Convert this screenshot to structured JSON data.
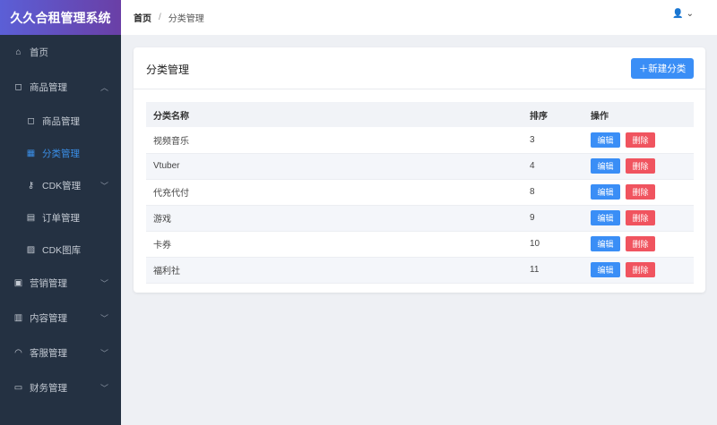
{
  "app_title": "久久合租管理系统",
  "sidebar": [
    {
      "label": "首页",
      "icon": "home-icon"
    },
    {
      "label": "商品管理",
      "icon": "bag-icon",
      "chevron": "up"
    },
    {
      "label": "商品管理",
      "icon": "bag-icon",
      "sub": true
    },
    {
      "label": "分类管理",
      "icon": "grid-icon",
      "sub": true,
      "active": true
    },
    {
      "label": "CDK管理",
      "icon": "key-icon",
      "sub": true,
      "chevron": "down"
    },
    {
      "label": "订单管理",
      "icon": "clipboard-icon",
      "sub": true
    },
    {
      "label": "CDK图库",
      "icon": "image-icon",
      "sub": true
    },
    {
      "label": "营销管理",
      "icon": "gift-icon",
      "chevron": "down"
    },
    {
      "label": "内容管理",
      "icon": "books-icon",
      "chevron": "down"
    },
    {
      "label": "客服管理",
      "icon": "headset-icon",
      "chevron": "down"
    },
    {
      "label": "财务管理",
      "icon": "card-icon",
      "chevron": "down"
    }
  ],
  "breadcrumb": {
    "home": "首页",
    "sep": "/",
    "current": "分类管理"
  },
  "card": {
    "title": "分类管理",
    "new_button": "＋新建分类"
  },
  "table": {
    "headers": [
      "分类名称",
      "排序",
      "操作"
    ],
    "rows": [
      [
        "视频音乐",
        "3"
      ],
      [
        "Vtuber",
        "4"
      ],
      [
        "代充代付",
        "8"
      ],
      [
        "游戏",
        "9"
      ],
      [
        "卡券",
        "10"
      ],
      [
        "福利社",
        "11"
      ]
    ],
    "edit": "编辑",
    "delete": "删除"
  },
  "colors": {
    "primary": "#3a8ef6",
    "danger": "#f0545f",
    "sidebar": "#243142"
  }
}
